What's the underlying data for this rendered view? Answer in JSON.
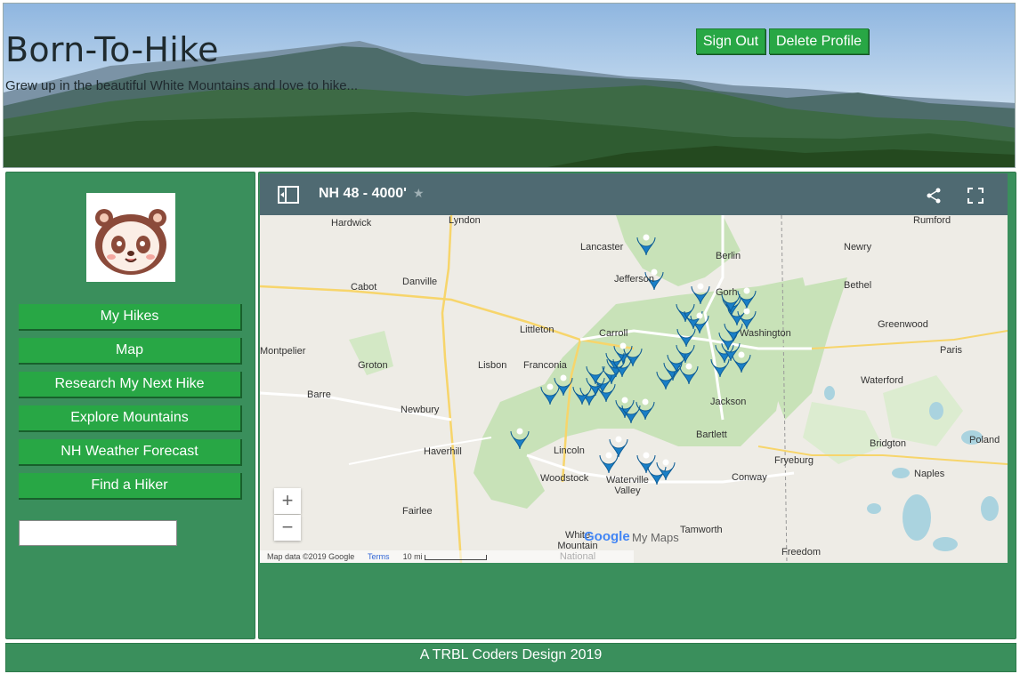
{
  "header": {
    "title": "Born-To-Hike",
    "tagline": "Grew up in the beautiful White Mountains and love to hike...",
    "sign_out_label": "Sign Out",
    "delete_profile_label": "Delete Profile"
  },
  "sidebar": {
    "avatar_icon": "panda-avatar-icon",
    "nav": [
      {
        "label": "My Hikes"
      },
      {
        "label": "Map"
      },
      {
        "label": "Research My Next Hike"
      },
      {
        "label": "Explore Mountains"
      },
      {
        "label": "NH Weather Forecast"
      },
      {
        "label": "Find a Hiker"
      }
    ],
    "search_value": ""
  },
  "map": {
    "title": "NH 48 - 4000'",
    "star": "★",
    "towns": [
      "Lyndon",
      "Hardwick",
      "Lancaster",
      "Berlin",
      "Rumford",
      "Newry",
      "Cabot",
      "Danville",
      "Jefferson",
      "Gorh",
      "Bethel",
      "Greenwood",
      "Montpelier",
      "Littleton",
      "Carroll",
      "Washington",
      "Paris",
      "Groton",
      "Lisbon",
      "Franconia",
      "Barre",
      "Waterford",
      "Jackson",
      "Newbury",
      "Bartlett",
      "Bridgton",
      "Poland",
      "Haverhill",
      "Lincoln",
      "Fryeburg",
      "Woodstock",
      "Waterville Valley",
      "Naples",
      "Conway",
      "Fairlee",
      "White Mountain National Forest",
      "Tamworth",
      "Freedom"
    ],
    "zoom_in": "+",
    "zoom_out": "−",
    "google_logo": "Google",
    "my_maps": "My Maps",
    "attribution": "Map data ©2019 Google",
    "terms": "Terms",
    "scale": "10 mi"
  },
  "footer": {
    "text": "A TRBL Coders Design 2019"
  },
  "colors": {
    "accent": "#28a745",
    "panel": "#3a8f5c",
    "map_bar": "#4f6a72",
    "pin": "#1a7fc7"
  }
}
